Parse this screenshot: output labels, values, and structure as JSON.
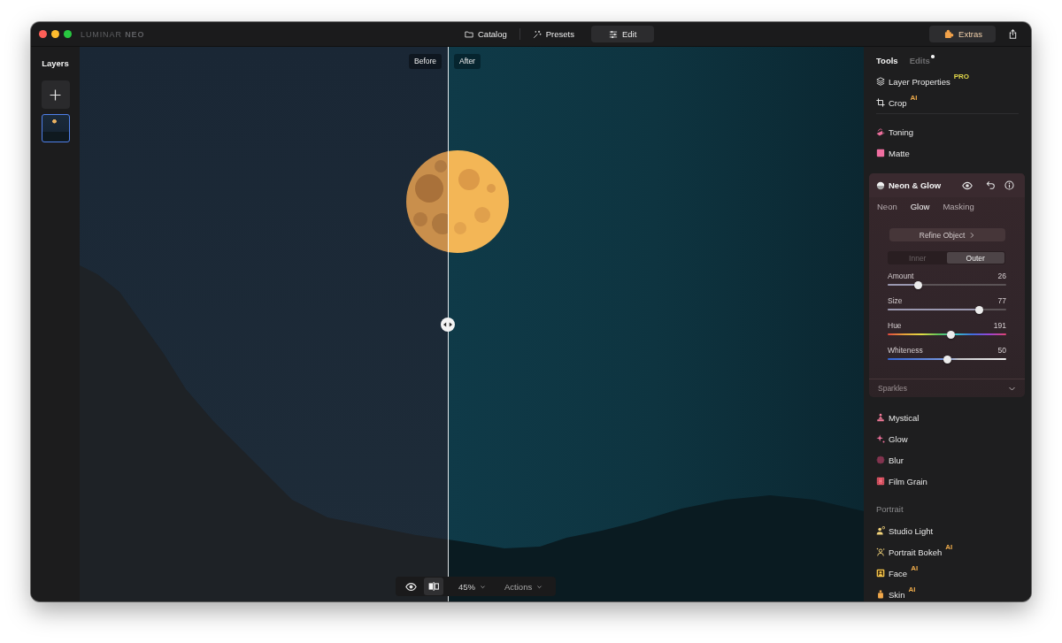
{
  "window": {
    "logo": "LUMINAR **NEO**",
    "nav_tabs": [
      {
        "label": "Catalog",
        "selected": false
      },
      {
        "label": "Presets",
        "selected": false
      },
      {
        "label": "Edit",
        "selected": true
      }
    ],
    "extras_button": "Extras"
  },
  "layers_panel": {
    "title": "Layers",
    "layers": [
      {
        "selected": true
      }
    ]
  },
  "canvas": {
    "before_label": "Before",
    "after_label": "After",
    "toolbar": {
      "compare_on": true,
      "zoom": "45%",
      "actions": "Actions"
    }
  },
  "tools_panel": {
    "tabs": [
      {
        "label": "Tools",
        "selected": true,
        "has_changes": false
      },
      {
        "label": "Edits",
        "selected": false,
        "has_changes": true
      }
    ],
    "groups": [
      {
        "items": [
          {
            "label": "Layer Properties",
            "expanded": false,
            "badge": {
              "text": "PRO",
              "kind": "pro"
            }
          },
          {
            "label": "Crop",
            "expanded": false,
            "badge": {
              "text": "AI",
              "kind": "ai"
            }
          }
        ]
      },
      {
        "items": [
          {
            "label": "Toning",
            "expanded": false
          },
          {
            "label": "Matte",
            "expanded": false
          },
          {
            "label": "Neon & Glow",
            "expanded": true,
            "tabs": [
              {
                "label": "Neon",
                "selected": false
              },
              {
                "label": "Glow",
                "selected": true
              },
              {
                "label": "Masking",
                "selected": false
              }
            ],
            "refine_button": "Refine Object",
            "modes": [
              {
                "label": "Inner",
                "selected": false
              },
              {
                "label": "Outer",
                "selected": true
              }
            ],
            "sliders": [
              {
                "label": "Amount",
                "reading": "26",
                "level": 0.26,
                "kind": "plain"
              },
              {
                "label": "Size",
                "reading": "77",
                "level": 0.77,
                "kind": "plain"
              },
              {
                "label": "Hue",
                "reading": "191",
                "level": 0.53,
                "kind": "hue"
              },
              {
                "label": "Whiteness",
                "reading": "50",
                "level": 0.5,
                "kind": "whiteness"
              }
            ],
            "sections": [
              {
                "label": "Sparkles",
                "expanded": false
              }
            ]
          },
          {
            "label": "Mystical",
            "expanded": false
          },
          {
            "label": "Glow",
            "expanded": false
          },
          {
            "label": "Blur",
            "expanded": false
          },
          {
            "label": "Film Grain",
            "expanded": false
          }
        ]
      },
      {
        "title": "Portrait",
        "items": [
          {
            "label": "Studio Light",
            "expanded": false
          },
          {
            "label": "Portrait Bokeh",
            "expanded": false,
            "badge": {
              "text": "AI",
              "kind": "ai"
            }
          },
          {
            "label": "Face",
            "expanded": false,
            "badge": {
              "text": "AI",
              "kind": "ai"
            }
          },
          {
            "label": "Skin",
            "expanded": false,
            "badge": {
              "text": "AI",
              "kind": "ai"
            }
          }
        ]
      }
    ]
  }
}
